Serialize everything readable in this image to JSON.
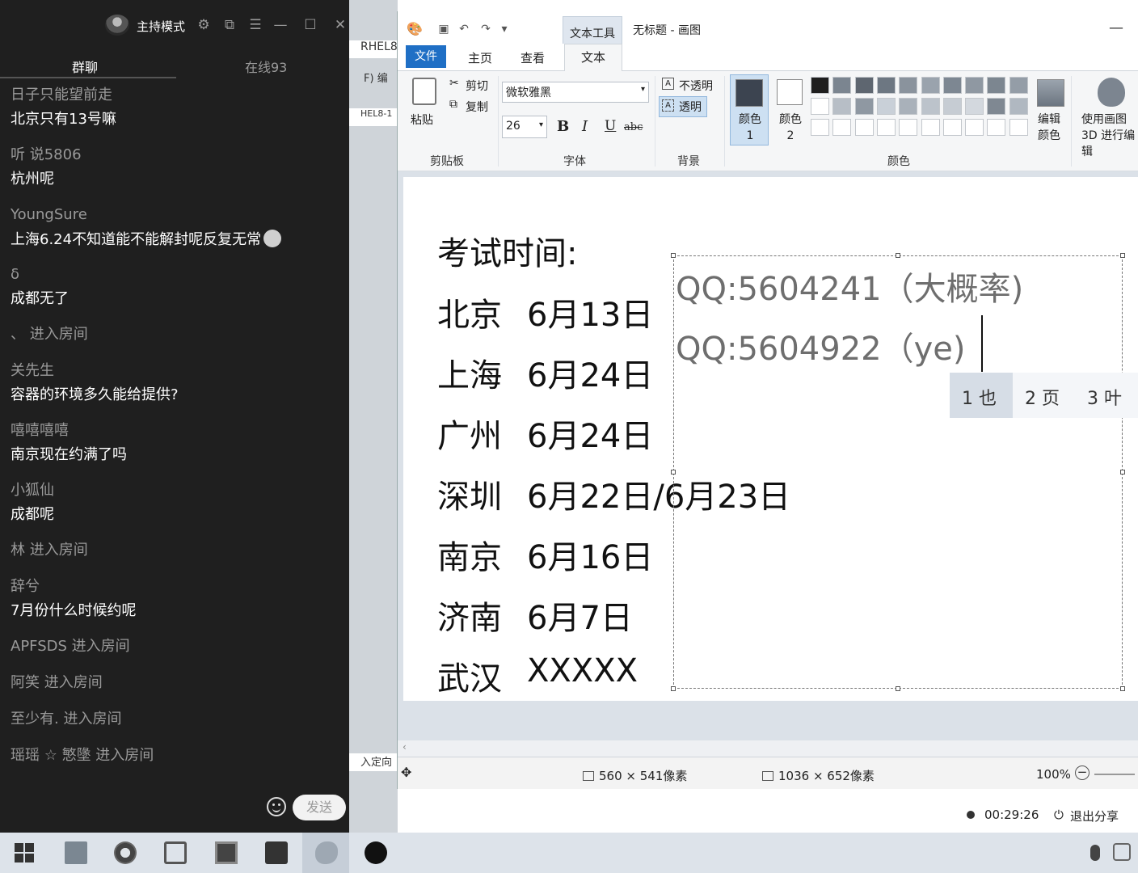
{
  "chat": {
    "host_mode": "主持模式",
    "tabs": [
      "群聊",
      "在线93"
    ],
    "messages": [
      {
        "name": "日子只能望前走",
        "text": "北京只有13号嘛"
      },
      {
        "name": "听 说5806",
        "text": "杭州呢"
      },
      {
        "name": "YoungSure",
        "text": "上海6.24不知道能不能解封呢反复无常"
      },
      {
        "name": "δ",
        "text": "成都无了"
      }
    ],
    "entry1": "、 进入房间",
    "messages2": [
      {
        "name": "关先生",
        "text": "容器的环境多久能给提供?"
      },
      {
        "name": "嘻嘻嘻嘻",
        "text": "南京现在约满了吗"
      },
      {
        "name": "小狐仙",
        "text": "成都呢"
      }
    ],
    "entry2": "林 进入房间",
    "messages3": [
      {
        "name": "辞兮",
        "text": "7月份什么时候约呢"
      }
    ],
    "entries3": [
      "APFSDS 进入房间",
      "阿笑 进入房间",
      "至少有. 进入房间",
      "瑶瑶 ☆ 慜墬 进入房间"
    ],
    "send_label": "发送"
  },
  "bgstrip": {
    "tab": "RHEL8",
    "f": "F)",
    "bian": "编",
    "tab2": "HEL8-1",
    "redirect": "入定向"
  },
  "paint": {
    "context_tab": "文本工具",
    "window_title": "无标题 - 画图",
    "tabs": {
      "file": "文件",
      "home": "主页",
      "view": "查看",
      "text": "文本"
    },
    "clipboard": {
      "paste": "粘贴",
      "cut": "剪切",
      "copy": "复制",
      "label": "剪贴板"
    },
    "font": {
      "name": "微软雅黑",
      "size": "26",
      "bold": "B",
      "italic": "I",
      "underline": "U",
      "strike": "abc",
      "label": "字体"
    },
    "background": {
      "opaque": "不透明",
      "transparent": "透明",
      "label": "背景"
    },
    "colors": {
      "color1": "颜色 1",
      "color2": "颜色 2",
      "edit": "编辑颜色",
      "paint3d": "使用画图 3D 进行编辑",
      "label": "颜色"
    },
    "palette_row1": [
      "#1e1e1e",
      "#7b8590",
      "#5e6670",
      "#6d7782",
      "#8a939d",
      "#9aa3ad",
      "#7d8792",
      "#8f98a2",
      "#7c8690",
      "#949da7"
    ],
    "palette_row2": [
      "#ffffff",
      "#b7bec6",
      "#8f98a2",
      "#c9d0d8",
      "#a9b1ba",
      "#bcc3cb",
      "#c6ccd3",
      "#d3d8de",
      "#7f8892",
      "#b0b8c1"
    ],
    "palette_row3": [
      "#ffffff",
      "#ffffff",
      "#ffffff",
      "#ffffff",
      "#ffffff",
      "#ffffff",
      "#ffffff",
      "#ffffff",
      "#ffffff",
      "#ffffff"
    ],
    "canvas": {
      "heading": "考试时间:",
      "rows": [
        {
          "city": "北京",
          "date": "6月13日"
        },
        {
          "city": "上海",
          "date": "6月24日"
        },
        {
          "city": "广州",
          "date": "6月24日"
        },
        {
          "city": "深圳",
          "date": "6月22日/6月23日"
        },
        {
          "city": "南京",
          "date": "6月16日"
        },
        {
          "city": "济南",
          "date": "6月7日"
        },
        {
          "city": "武汉",
          "date": "XXXXX"
        }
      ],
      "qq1": "QQ:5604241（大概率)",
      "qq2": "QQ:5604922（ye)"
    },
    "ime": [
      "1 也",
      "2 页",
      "3 叶"
    ],
    "status": {
      "selection": "560 × 541像素",
      "canvas_size": "1036 × 652像素",
      "zoom": "100%"
    }
  },
  "share": {
    "timer": "00:29:26",
    "exit": "退出分享"
  }
}
